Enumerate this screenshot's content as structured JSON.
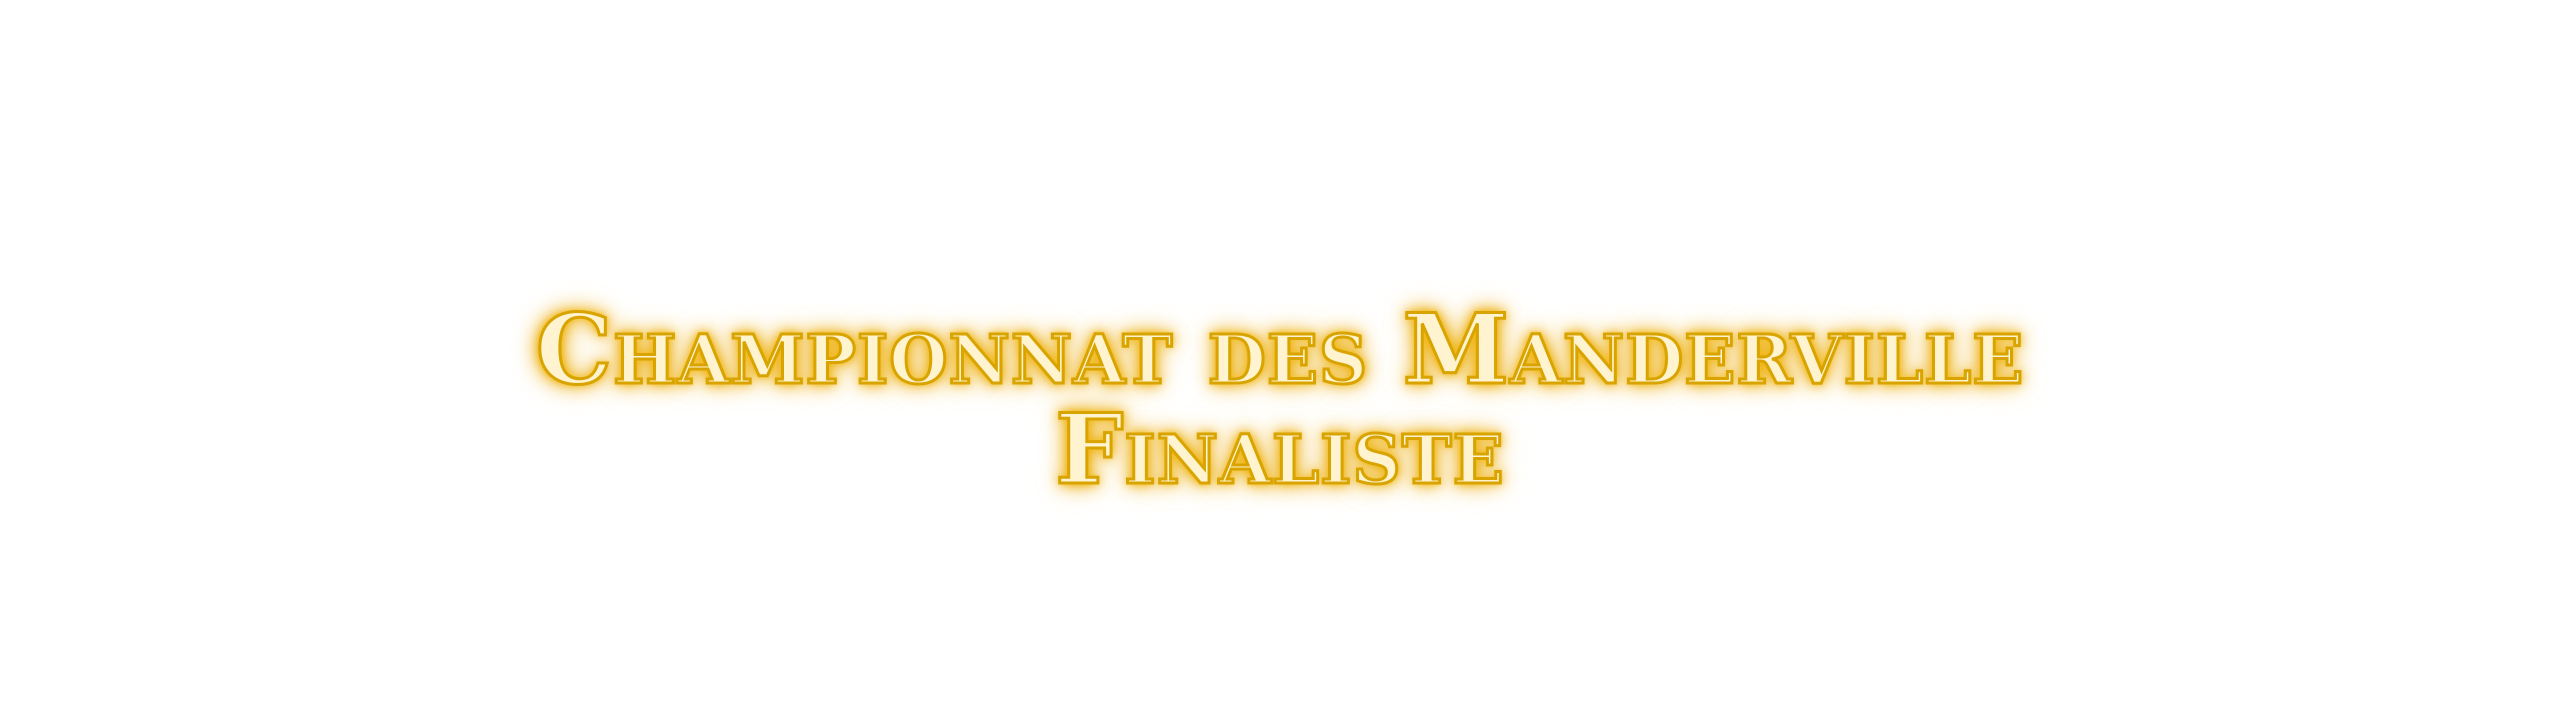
{
  "achievement": {
    "line1": "Championnat des Manderville",
    "line2": "Finaliste"
  },
  "colors": {
    "text_fill": "#fff4cf",
    "text_outline": "#d9a400",
    "glow": "#f0b000",
    "background": "#ffffff"
  }
}
